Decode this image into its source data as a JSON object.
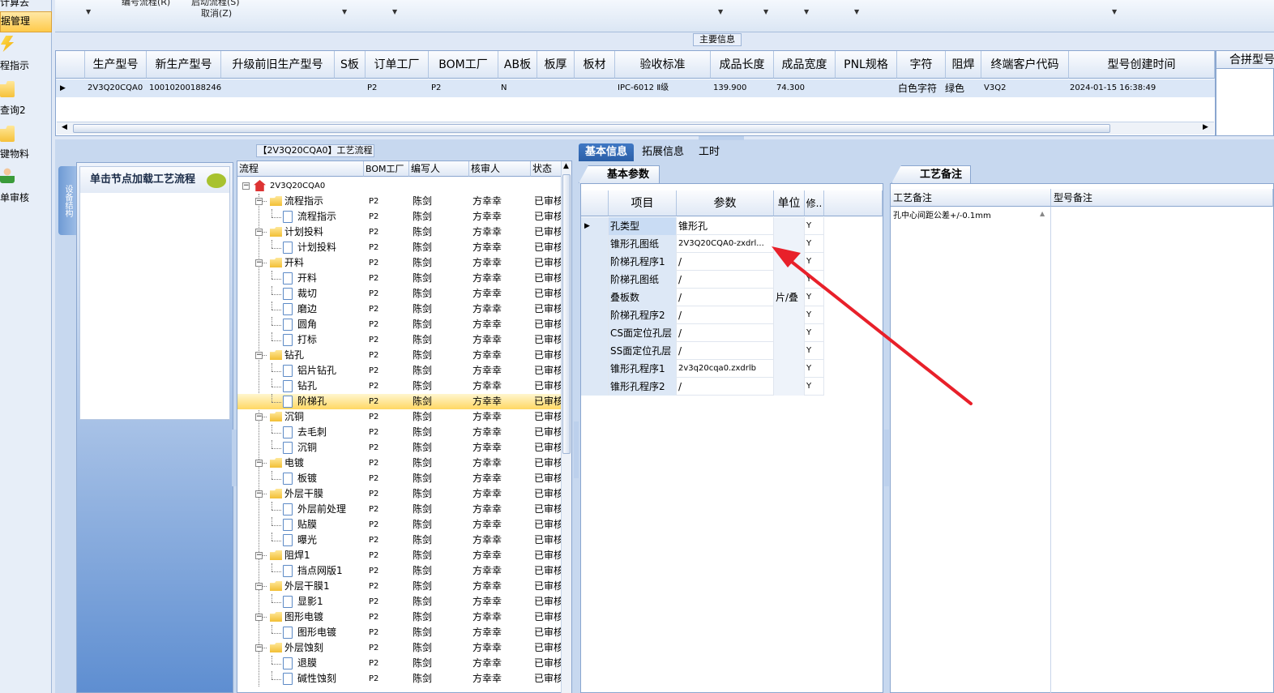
{
  "left_nav": {
    "items": [
      {
        "label": "计算去",
        "icon": "none"
      },
      {
        "label": "据管理",
        "icon": "none"
      },
      {
        "label": "程指示",
        "icon": "bolt-icon"
      },
      {
        "label": "查询2",
        "icon": "folder-icon"
      },
      {
        "label": "键物料",
        "icon": "folder-icon"
      },
      {
        "label": "单审核",
        "icon": "user-icon"
      }
    ]
  },
  "toolbar": {
    "items": [
      "编号流程(R)",
      "启动流程(S)",
      "取消(Z)"
    ]
  },
  "main_info": {
    "legend": "主要信息",
    "columns": [
      "生产型号",
      "新生产型号",
      "升级前旧生产型号",
      "S板",
      "订单工厂",
      "BOM工厂",
      "AB板",
      "板厚",
      "板材",
      "验收标准",
      "成品长度",
      "成品宽度",
      "PNL规格",
      "字符",
      "阻焊",
      "终端客户代码",
      "型号创建时间"
    ],
    "row": [
      "2V3Q20CQA0",
      "10010200188246",
      "",
      "",
      "P2",
      "P2",
      "N",
      "",
      "",
      "IPC-6012 Ⅱ级",
      "139.900",
      "74.300",
      "",
      "白色字符",
      "绿色",
      "V3Q2",
      "2024-01-15 16:38:49"
    ],
    "combined_header": "合拼型号"
  },
  "left_panel": {
    "vertical_tab": "设备结构",
    "message": "单击节点加载工艺流程"
  },
  "flow": {
    "legend": "【2V3Q20CQA0】工艺流程",
    "columns": [
      "流程",
      "BOM工厂",
      "编写人",
      "核审人",
      "状态"
    ],
    "root": "2V3Q20CQA0",
    "rows": [
      {
        "name": "流程指示",
        "type": "folder",
        "bom": "P2",
        "author": "陈剑",
        "reviewer": "方幸幸",
        "status": "已审核"
      },
      {
        "name": "流程指示",
        "type": "doc",
        "bom": "P2",
        "author": "陈剑",
        "reviewer": "方幸幸",
        "status": "已审核"
      },
      {
        "name": "计划投料",
        "type": "folder",
        "bom": "P2",
        "author": "陈剑",
        "reviewer": "方幸幸",
        "status": "已审核"
      },
      {
        "name": "计划投料",
        "type": "doc",
        "bom": "P2",
        "author": "陈剑",
        "reviewer": "方幸幸",
        "status": "已审核"
      },
      {
        "name": "开料",
        "type": "folder",
        "bom": "P2",
        "author": "陈剑",
        "reviewer": "方幸幸",
        "status": "已审核"
      },
      {
        "name": "开料",
        "type": "doc",
        "bom": "P2",
        "author": "陈剑",
        "reviewer": "方幸幸",
        "status": "已审核"
      },
      {
        "name": "裁切",
        "type": "doc",
        "bom": "P2",
        "author": "陈剑",
        "reviewer": "方幸幸",
        "status": "已审核"
      },
      {
        "name": "磨边",
        "type": "doc",
        "bom": "P2",
        "author": "陈剑",
        "reviewer": "方幸幸",
        "status": "已审核"
      },
      {
        "name": "圆角",
        "type": "doc",
        "bom": "P2",
        "author": "陈剑",
        "reviewer": "方幸幸",
        "status": "已审核"
      },
      {
        "name": "打标",
        "type": "doc",
        "bom": "P2",
        "author": "陈剑",
        "reviewer": "方幸幸",
        "status": "已审核"
      },
      {
        "name": "钻孔",
        "type": "folder",
        "bom": "P2",
        "author": "陈剑",
        "reviewer": "方幸幸",
        "status": "已审核"
      },
      {
        "name": "铝片钻孔",
        "type": "doc",
        "bom": "P2",
        "author": "陈剑",
        "reviewer": "方幸幸",
        "status": "已审核"
      },
      {
        "name": "钻孔",
        "type": "doc",
        "bom": "P2",
        "author": "陈剑",
        "reviewer": "方幸幸",
        "status": "已审核"
      },
      {
        "name": "阶梯孔",
        "type": "doc",
        "bom": "P2",
        "author": "陈剑",
        "reviewer": "方幸幸",
        "status": "已审核",
        "selected": true
      },
      {
        "name": "沉铜",
        "type": "folder",
        "bom": "P2",
        "author": "陈剑",
        "reviewer": "方幸幸",
        "status": "已审核"
      },
      {
        "name": "去毛刺",
        "type": "doc",
        "bom": "P2",
        "author": "陈剑",
        "reviewer": "方幸幸",
        "status": "已审核"
      },
      {
        "name": "沉铜",
        "type": "doc",
        "bom": "P2",
        "author": "陈剑",
        "reviewer": "方幸幸",
        "status": "已审核"
      },
      {
        "name": "电镀",
        "type": "folder",
        "bom": "P2",
        "author": "陈剑",
        "reviewer": "方幸幸",
        "status": "已审核"
      },
      {
        "name": "板镀",
        "type": "doc",
        "bom": "P2",
        "author": "陈剑",
        "reviewer": "方幸幸",
        "status": "已审核"
      },
      {
        "name": "外层干膜",
        "type": "folder",
        "bom": "P2",
        "author": "陈剑",
        "reviewer": "方幸幸",
        "status": "已审核"
      },
      {
        "name": "外层前处理",
        "type": "doc",
        "bom": "P2",
        "author": "陈剑",
        "reviewer": "方幸幸",
        "status": "已审核"
      },
      {
        "name": "贴膜",
        "type": "doc",
        "bom": "P2",
        "author": "陈剑",
        "reviewer": "方幸幸",
        "status": "已审核"
      },
      {
        "name": "曝光",
        "type": "doc",
        "bom": "P2",
        "author": "陈剑",
        "reviewer": "方幸幸",
        "status": "已审核"
      },
      {
        "name": "阻焊1",
        "type": "folder",
        "bom": "P2",
        "author": "陈剑",
        "reviewer": "方幸幸",
        "status": "已审核"
      },
      {
        "name": "挡点网版1",
        "type": "doc",
        "bom": "P2",
        "author": "陈剑",
        "reviewer": "方幸幸",
        "status": "已审核"
      },
      {
        "name": "外层干膜1",
        "type": "folder",
        "bom": "P2",
        "author": "陈剑",
        "reviewer": "方幸幸",
        "status": "已审核"
      },
      {
        "name": "显影1",
        "type": "doc",
        "bom": "P2",
        "author": "陈剑",
        "reviewer": "方幸幸",
        "status": "已审核"
      },
      {
        "name": "图形电镀",
        "type": "folder",
        "bom": "P2",
        "author": "陈剑",
        "reviewer": "方幸幸",
        "status": "已审核"
      },
      {
        "name": "图形电镀",
        "type": "doc",
        "bom": "P2",
        "author": "陈剑",
        "reviewer": "方幸幸",
        "status": "已审核"
      },
      {
        "name": "外层蚀刻",
        "type": "folder",
        "bom": "P2",
        "author": "陈剑",
        "reviewer": "方幸幸",
        "status": "已审核"
      },
      {
        "name": "退膜",
        "type": "doc",
        "bom": "P2",
        "author": "陈剑",
        "reviewer": "方幸幸",
        "status": "已审核"
      },
      {
        "name": "碱性蚀刻",
        "type": "doc",
        "bom": "P2",
        "author": "陈剑",
        "reviewer": "方幸幸",
        "status": "已审核"
      }
    ]
  },
  "tabs": [
    "基本信息",
    "拓展信息",
    "工时"
  ],
  "basic_params": {
    "caption": "基本参数",
    "columns": [
      "项目",
      "参数",
      "单位",
      "修.."
    ],
    "rows": [
      {
        "item": "孔类型",
        "value": "锥形孔",
        "unit": "",
        "mod": "Y"
      },
      {
        "item": "锥形孔图纸",
        "value": "2V3Q20CQA0-zxdrl...",
        "unit": "",
        "mod": "Y"
      },
      {
        "item": "阶梯孔程序1",
        "value": "/",
        "unit": "",
        "mod": "Y"
      },
      {
        "item": "阶梯孔图纸",
        "value": "/",
        "unit": "",
        "mod": "Y"
      },
      {
        "item": "叠板数",
        "value": "/",
        "unit": "片/叠",
        "mod": "Y"
      },
      {
        "item": "阶梯孔程序2",
        "value": "/",
        "unit": "",
        "mod": "Y"
      },
      {
        "item": "CS面定位孔层",
        "value": "/",
        "unit": "",
        "mod": "Y"
      },
      {
        "item": "SS面定位孔层",
        "value": "/",
        "unit": "",
        "mod": "Y"
      },
      {
        "item": "锥形孔程序1",
        "value": "2v3q20cqa0.zxdrlb",
        "unit": "",
        "mod": "Y"
      },
      {
        "item": "锥形孔程序2",
        "value": "/",
        "unit": "",
        "mod": "Y"
      }
    ]
  },
  "remarks": {
    "caption": "工艺备注",
    "columns": [
      "工艺备注",
      "型号备注"
    ],
    "process_remark": "孔中心间距公差+/-0.1mm"
  },
  "colors": {
    "accent": "#2b5fa8",
    "selection": "#ffd863",
    "annotation_arrow": "#e8202a"
  }
}
